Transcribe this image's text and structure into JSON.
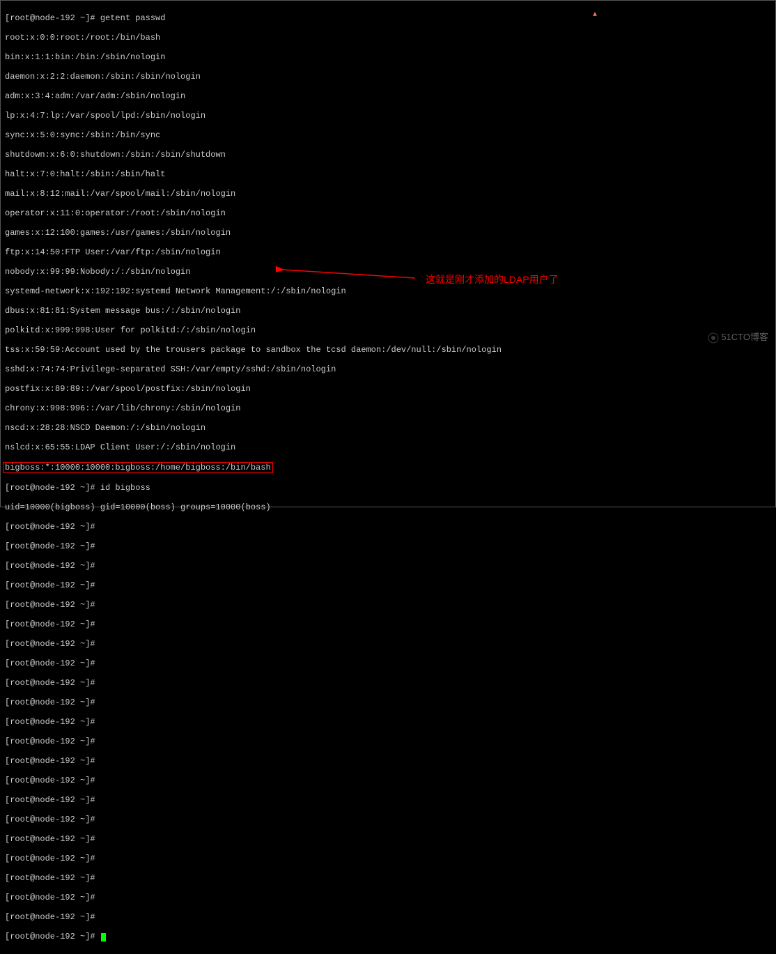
{
  "prompt": "[root@node-192 ~]# ",
  "command1": "getent passwd",
  "passwd_lines": [
    "root:x:0:0:root:/root:/bin/bash",
    "bin:x:1:1:bin:/bin:/sbin/nologin",
    "daemon:x:2:2:daemon:/sbin:/sbin/nologin",
    "adm:x:3:4:adm:/var/adm:/sbin/nologin",
    "lp:x:4:7:lp:/var/spool/lpd:/sbin/nologin",
    "sync:x:5:0:sync:/sbin:/bin/sync",
    "shutdown:x:6:0:shutdown:/sbin:/sbin/shutdown",
    "halt:x:7:0:halt:/sbin:/sbin/halt",
    "mail:x:8:12:mail:/var/spool/mail:/sbin/nologin",
    "operator:x:11:0:operator:/root:/sbin/nologin",
    "games:x:12:100:games:/usr/games:/sbin/nologin",
    "ftp:x:14:50:FTP User:/var/ftp:/sbin/nologin",
    "nobody:x:99:99:Nobody:/:/sbin/nologin",
    "systemd-network:x:192:192:systemd Network Management:/:/sbin/nologin",
    "dbus:x:81:81:System message bus:/:/sbin/nologin",
    "polkitd:x:999:998:User for polkitd:/:/sbin/nologin",
    "tss:x:59:59:Account used by the trousers package to sandbox the tcsd daemon:/dev/null:/sbin/nologin",
    "sshd:x:74:74:Privilege-separated SSH:/var/empty/sshd:/sbin/nologin",
    "postfix:x:89:89::/var/spool/postfix:/sbin/nologin",
    "chrony:x:998:996::/var/lib/chrony:/sbin/nologin",
    "nscd:x:28:28:NSCD Daemon:/:/sbin/nologin",
    "nslcd:x:65:55:LDAP Client User:/:/sbin/nologin"
  ],
  "highlighted_line": "bigboss:*:10000:10000:bigboss:/home/bigboss:/bin/bash",
  "command2": "id bigboss",
  "id_output": "uid=10000(bigboss) gid=10000(boss) groups=10000(boss)",
  "empty_prompt_count": 21,
  "annotation_text": "这就是刚才添加的LDAP用户了",
  "watermark_text": "51CTO博客",
  "cursor_pointer": "▲"
}
